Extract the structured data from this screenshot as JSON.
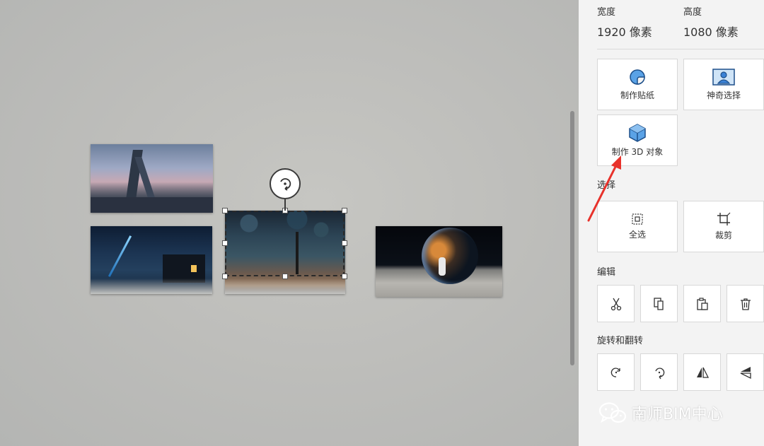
{
  "panel": {
    "width_label": "宽度",
    "width_value": "1920 像素",
    "height_label": "高度",
    "height_value": "1080 像素",
    "tools": [
      {
        "label": "制作贴纸",
        "icon": "sticker-icon"
      },
      {
        "label": "神奇选择",
        "icon": "magic-select-icon"
      },
      {
        "label": "制作 3D 对象",
        "icon": "cube-icon"
      }
    ],
    "select_section": "选择",
    "select_all_label": "全选",
    "crop_label": "裁剪",
    "edit_section": "编辑",
    "edit_tools": [
      "cut-icon",
      "copy-icon",
      "paste-icon",
      "delete-icon"
    ],
    "rotate_section": "旋转和翻转",
    "rotate_tools": [
      "rotate-left-icon",
      "rotate-right-icon",
      "flip-horizontal-icon",
      "flip-vertical-icon"
    ]
  },
  "watermark": {
    "text": "南师BIM中心",
    "icon": "wechat-icon"
  },
  "colors": {
    "accent_red": "#e8322b",
    "icon_blue": "#3b82d6",
    "panel_bg": "#f3f3f3"
  }
}
